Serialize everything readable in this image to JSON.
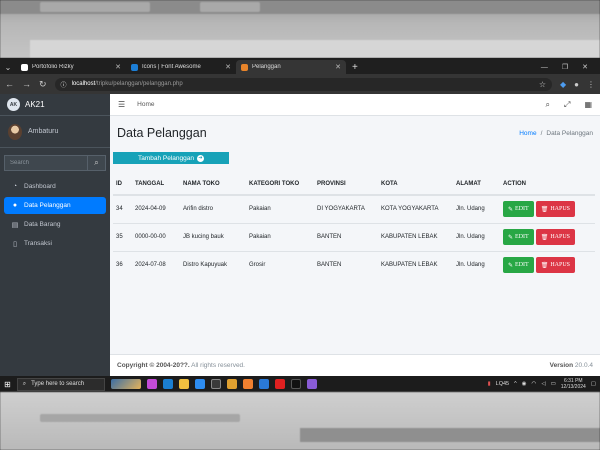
{
  "browser": {
    "tabs": [
      {
        "title": "Portofolio Rizky",
        "favicon_color": "#ffffff",
        "active": false
      },
      {
        "title": "Icons | Font Awesome",
        "favicon_color": "#1c7ed6",
        "active": false
      },
      {
        "title": "Pelanggan",
        "favicon_color": "#e8842a",
        "active": true
      }
    ],
    "url_host": "localhost",
    "url_path": "/tripku/pelanggan/pelanggan.php"
  },
  "sidebar": {
    "brand": "AK21",
    "user_name": "Ambaturu",
    "search_placeholder": "Search",
    "items": [
      {
        "label": "Dashboard",
        "icon": "dashboard-icon",
        "active": false
      },
      {
        "label": "Data Pelanggan",
        "icon": "user-icon",
        "active": true
      },
      {
        "label": "Data Barang",
        "icon": "file-icon",
        "active": false
      },
      {
        "label": "Transaksi",
        "icon": "file-icon",
        "active": false
      }
    ]
  },
  "topnav": {
    "home": "Home"
  },
  "page": {
    "title": "Data Pelanggan",
    "breadcrumb_home": "Home",
    "breadcrumb_sep": "/",
    "breadcrumb_current": "Data Pelanggan",
    "add_button": "Tambah Pelanggan"
  },
  "table": {
    "headers": [
      "ID",
      "TANGGAL",
      "NAMA TOKO",
      "KATEGORI TOKO",
      "PROVINSI",
      "KOTA",
      "ALAMAT",
      "ACTION"
    ],
    "rows": [
      [
        "34",
        "2024-04-09",
        "Arifin distro",
        "Pakaian",
        "DI YOGYAKARTA",
        "KOTA YOGYAKARTA",
        "Jln. Udang"
      ],
      [
        "35",
        "0000-00-00",
        "JB kucing bauk",
        "Pakaian",
        "BANTEN",
        "KABUPATEN LEBAK",
        "Jln. Udang"
      ],
      [
        "36",
        "2024-07-08",
        "Distro Kapuyuak",
        "Grosir",
        "BANTEN",
        "KABUPATEN LEBAK",
        "Jln. Udang"
      ]
    ],
    "edit_label": "EDIT",
    "delete_label": "HAPUS"
  },
  "footer": {
    "copyright": "Copyright © 2004-20??.",
    "rights": "All rights reserved.",
    "version_label": "Version",
    "version": "20.0.4"
  },
  "taskbar": {
    "search_placeholder": "Type here to search",
    "weather": "LQ45",
    "time": "6:31 PM",
    "date": "12/13/2024"
  },
  "colors": {
    "sidebar_bg": "#343a40",
    "active_blue": "#007bff",
    "info": "#17a2b8",
    "success": "#28a745",
    "danger": "#dc3545"
  }
}
